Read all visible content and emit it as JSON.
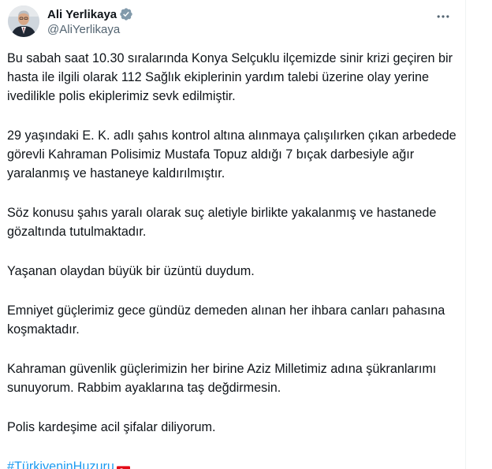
{
  "author": {
    "display_name": "Ali Yerlikaya",
    "handle": "@AliYerlikaya"
  },
  "icons": {
    "verified": "verified-badge-icon",
    "more": "more-options-icon",
    "flag": "turkey-flag-icon"
  },
  "colors": {
    "text": "#0f1419",
    "secondary": "#536471",
    "link": "#1d9bf0",
    "verified": "#829aab",
    "flag": "#e30a17"
  },
  "tweet": {
    "paragraphs": [
      "Bu sabah saat 10.30 sıralarında Konya Selçuklu ilçemizde sinir krizi geçiren bir hasta ile ilgili olarak 112 Sağlık ekiplerinin yardım talebi üzerine olay yerine ivedilikle polis ekiplerimiz sevk edilmiştir.",
      "29 yaşındaki E. K. adlı şahıs kontrol altına alınmaya çalışılırken çıkan arbedede görevli Kahraman Polisimiz Mustafa Topuz aldığı 7 bıçak darbesiyle ağır yaralanmış ve hastaneye kaldırılmıştır.",
      "Söz konusu şahıs yaralı olarak suç aletiyle birlikte yakalanmış ve hastanede gözaltında tutulmaktadır.",
      "Yaşanan olaydan büyük bir üzüntü duydum.",
      "Emniyet güçlerimiz gece gündüz demeden alınan her ihbara canları pahasına koşmaktadır.",
      "Kahraman güvenlik güçlerimizin her birine Aziz Milletimiz adına şükranlarımı sunuyorum. Rabbim ayaklarına taş değdirmesin.",
      "Polis kardeşime acil şifalar diliyorum."
    ],
    "hashtag": "#TürkiyeninHuzuru"
  }
}
